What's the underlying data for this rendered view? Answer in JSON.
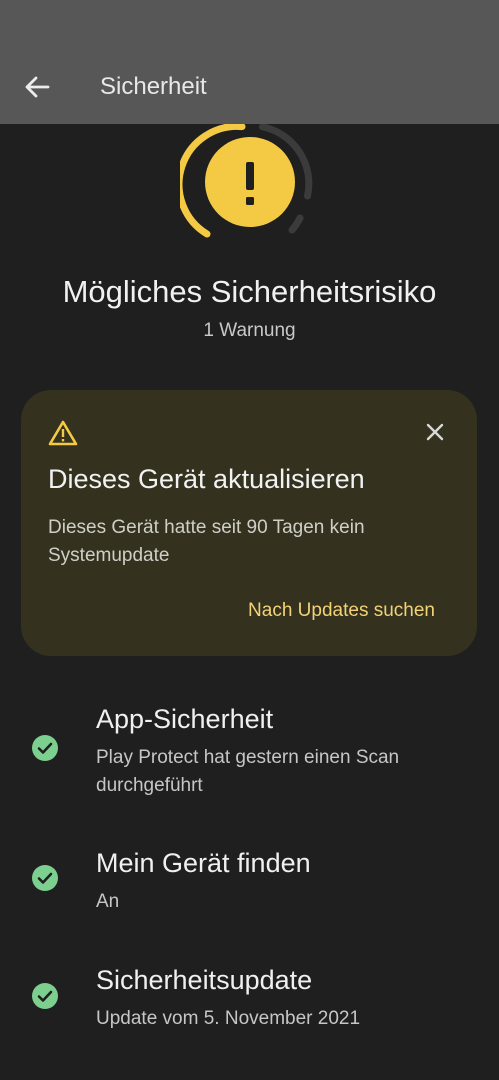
{
  "appbar": {
    "title": "Sicherheit",
    "back_icon": "arrow-back-icon"
  },
  "status": {
    "title": "Mögliches Sicherheitsrisiko",
    "subtitle": "1 Warnung",
    "icon": "exclamation-icon",
    "colors": {
      "warning": "#f4c944",
      "ring_inactive": "#3b3b3b"
    }
  },
  "alert_card": {
    "icon": "warning-triangle-icon",
    "close_icon": "close-icon",
    "title": "Dieses Gerät aktualisieren",
    "body": "Dieses Gerät hatte seit 90 Tagen kein Systemupdate",
    "action_label": "Nach Updates suchen",
    "colors": {
      "background": "#34321f",
      "action": "#f2d277"
    }
  },
  "items": [
    {
      "icon": "check-circle-icon",
      "title": "App-Sicherheit",
      "subtitle": "Play Protect hat gestern einen Scan durchgeführt"
    },
    {
      "icon": "check-circle-icon",
      "title": "Mein Gerät finden",
      "subtitle": "An"
    },
    {
      "icon": "check-circle-icon",
      "title": "Sicherheitsupdate",
      "subtitle": "Update vom 5. November 2021"
    }
  ],
  "colors": {
    "ok": "#7ccf8f",
    "background": "#1f1f1f",
    "appbar": "#575757"
  }
}
